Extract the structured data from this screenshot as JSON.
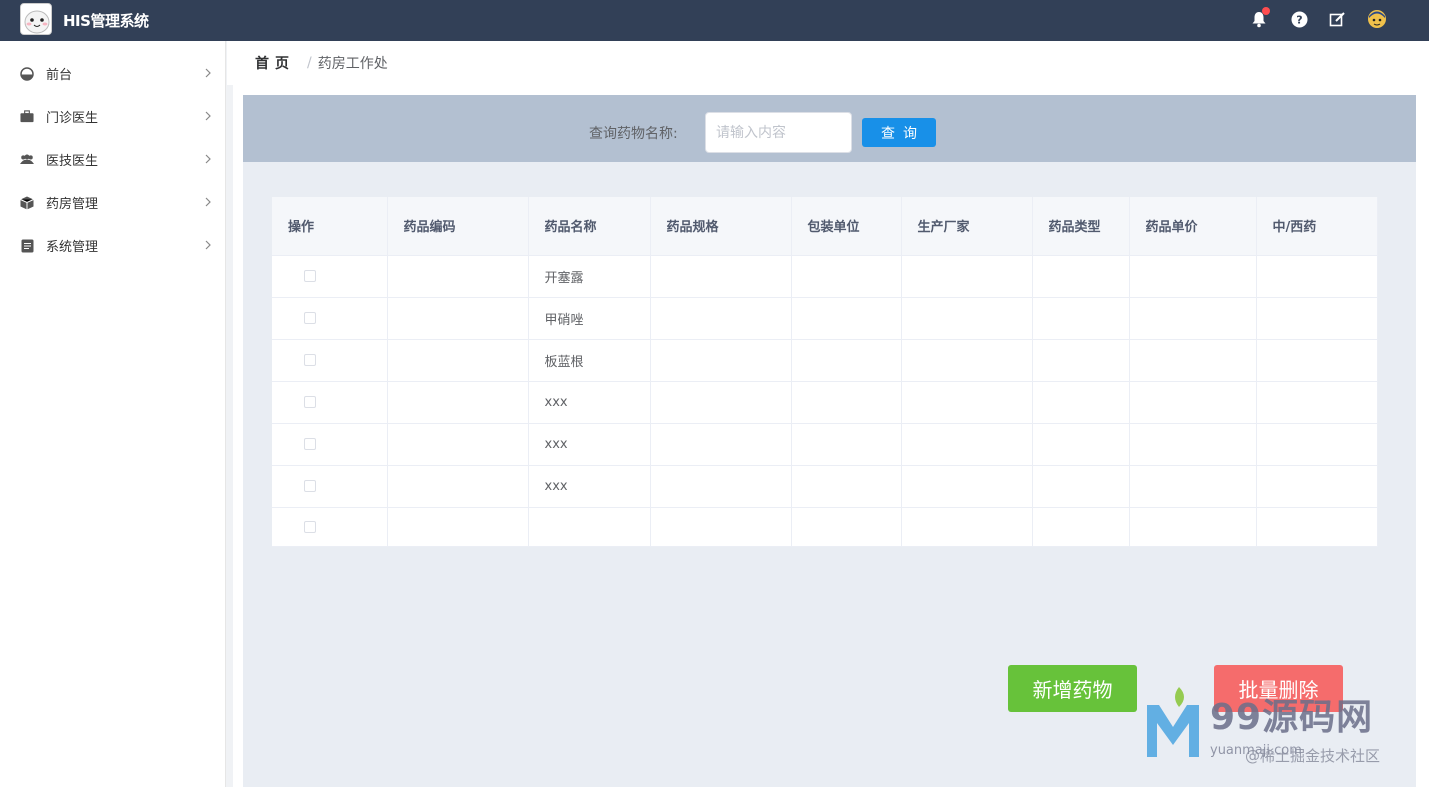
{
  "app": {
    "title": "HIS管理系统"
  },
  "topbar": {
    "icons": [
      "bell-icon",
      "help-icon",
      "edit-icon",
      "user-avatar"
    ]
  },
  "sidebar": {
    "items": [
      {
        "label": "前台",
        "icon": "dashboard-icon"
      },
      {
        "label": "门诊医生",
        "icon": "briefcase-icon"
      },
      {
        "label": "医技医生",
        "icon": "users-icon"
      },
      {
        "label": "药房管理",
        "icon": "cube-icon"
      },
      {
        "label": "系统管理",
        "icon": "document-icon"
      }
    ]
  },
  "breadcrumb": {
    "home": "首页",
    "separator": "/",
    "current": "药房工作处"
  },
  "search": {
    "label": "查询药物名称:",
    "placeholder": "请输入内容",
    "button": "查询"
  },
  "table": {
    "headers": [
      "操作",
      "药品编码",
      "药品名称",
      "药品规格",
      "包装单位",
      "生产厂家",
      "药品类型",
      "药品单价",
      "中/西药"
    ],
    "rows": [
      {
        "name": "开塞露"
      },
      {
        "name": "甲硝唑"
      },
      {
        "name": "板蓝根"
      },
      {
        "name": "xxx"
      },
      {
        "name": "xxx"
      },
      {
        "name": "xxx"
      },
      {
        "name": ""
      }
    ]
  },
  "actions": {
    "add": "新增药物",
    "batch_delete": "批量删除"
  },
  "watermark": {
    "brand": "99源码网",
    "url": "yuanmaji.com",
    "credit": "@稀土掘金技术社区"
  },
  "colors": {
    "topbar": "#324057",
    "search_bar": "#b3c0d1",
    "primary": "#1890e8",
    "success": "#67c23a",
    "danger": "#f56c6c"
  }
}
